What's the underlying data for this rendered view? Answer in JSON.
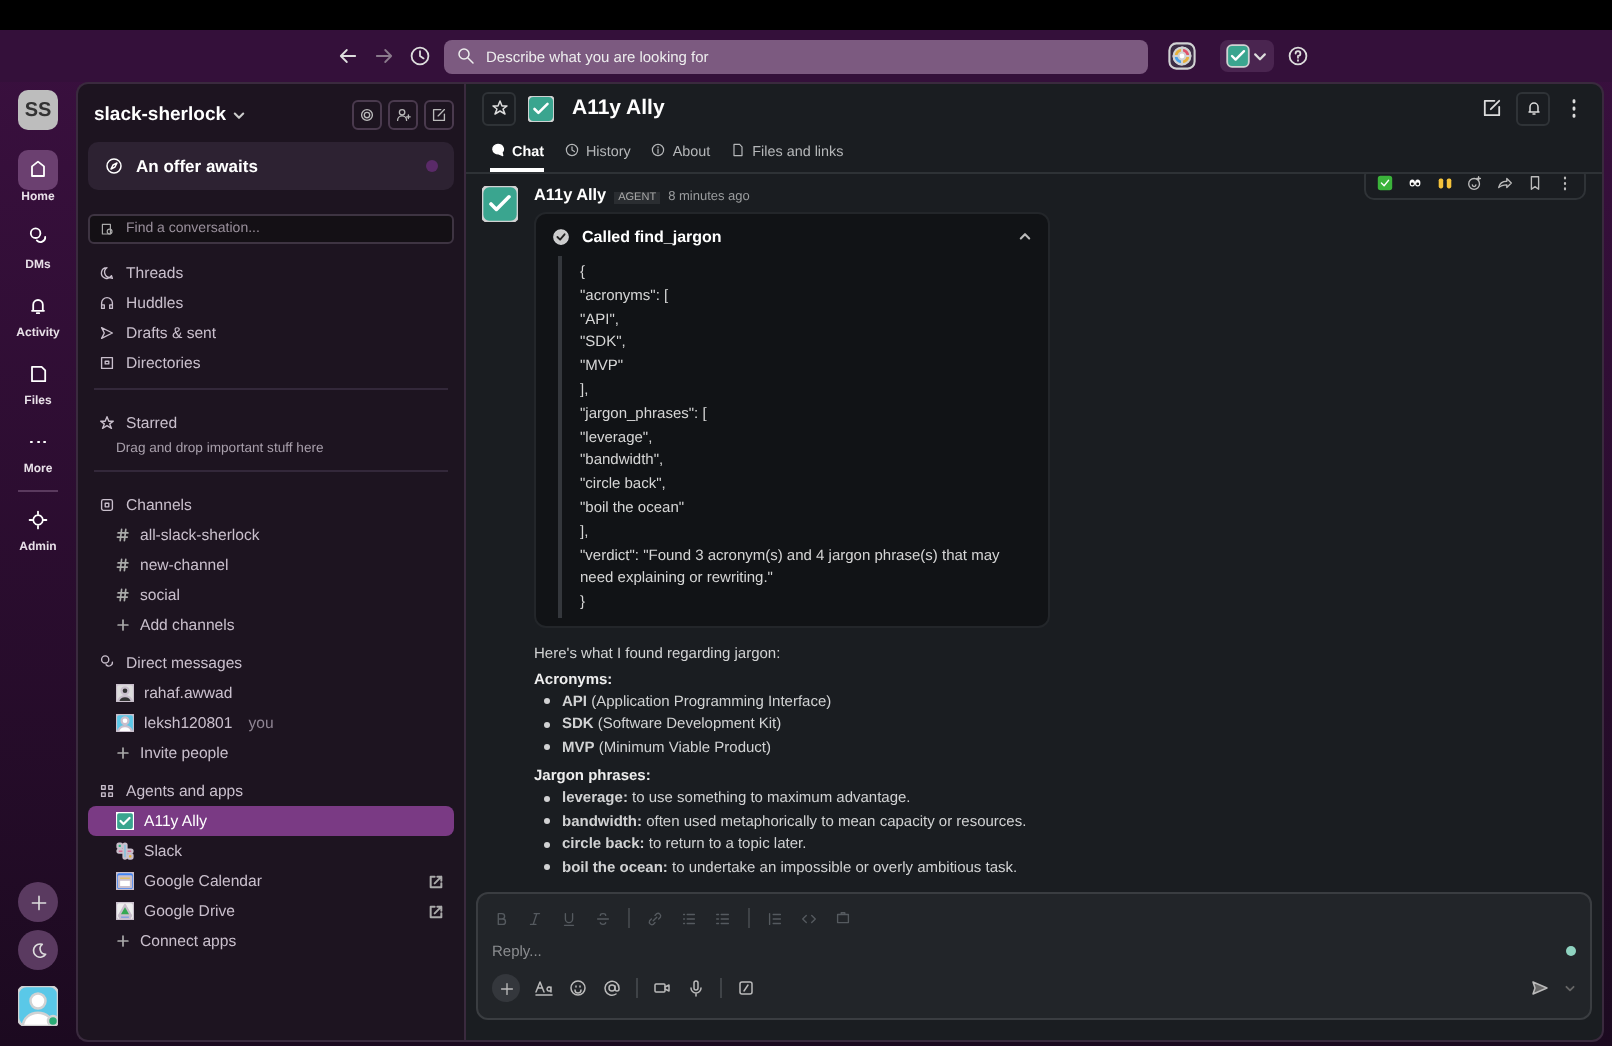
{
  "top_bar": {
    "search_placeholder": "Describe what you are looking for"
  },
  "rail": {
    "workspace_initials": "SS",
    "items": [
      {
        "label": "Home",
        "selected": true
      },
      {
        "label": "DMs",
        "selected": false
      },
      {
        "label": "Activity",
        "selected": false
      },
      {
        "label": "Files",
        "selected": false
      },
      {
        "label": "More",
        "selected": false
      },
      {
        "label": "Admin",
        "selected": false
      }
    ]
  },
  "sidebar": {
    "workspace": "slack-sherlock",
    "offer": "An offer awaits",
    "search_placeholder": "Find a conversation...",
    "nav": [
      "Threads",
      "Huddles",
      "Drafts & sent",
      "Directories"
    ],
    "starred": {
      "title": "Starred",
      "hint": "Drag and drop important stuff here"
    },
    "channels": {
      "title": "Channels",
      "items": [
        "all-slack-sherlock",
        "new-channel",
        "social"
      ],
      "add": "Add channels"
    },
    "direct_messages": {
      "title": "Direct messages",
      "items": [
        {
          "name": "rahaf.awwad"
        },
        {
          "name": "leksh120801",
          "suffix": "you"
        }
      ],
      "add": "Invite people"
    },
    "apps": {
      "title": "Agents and apps",
      "items": [
        {
          "name": "A11y Ally",
          "selected": true,
          "external": false
        },
        {
          "name": "Slack",
          "selected": false,
          "external": false
        },
        {
          "name": "Google Calendar",
          "selected": false,
          "external": true
        },
        {
          "name": "Google Drive",
          "selected": false,
          "external": true
        }
      ],
      "add": "Connect apps"
    }
  },
  "channel": {
    "title": "A11y Ally",
    "tabs": [
      {
        "label": "Chat",
        "selected": true
      },
      {
        "label": "History",
        "selected": false
      },
      {
        "label": "About",
        "selected": false
      },
      {
        "label": "Files and links",
        "selected": false
      }
    ]
  },
  "message": {
    "author": "A11y Ally",
    "badge": "AGENT",
    "time": "8 minutes ago",
    "tool_call": {
      "title": "Called find_jargon",
      "expanded": true,
      "lines": [
        "{",
        "\"acronyms\": [",
        "\"API\",",
        "\"SDK\",",
        "\"MVP\"",
        "],",
        "\"jargon_phrases\": [",
        "\"leverage\",",
        "\"bandwidth\",",
        "\"circle back\",",
        "\"boil the ocean\"",
        "],",
        "\"verdict\": \"Found 3 acronym(s) and 4 jargon phrase(s) that may need explaining or rewriting.\"",
        "}"
      ]
    },
    "intro": "Here's what I found regarding jargon:",
    "groups": [
      {
        "heading": "Acronyms:",
        "items": [
          "**API** (Application Programming Interface)",
          "**SDK** (Software Development Kit)",
          "**MVP** (Minimum Viable Product)"
        ]
      },
      {
        "heading": "Jargon phrases:",
        "items": [
          "**leverage:** to use something to maximum advantage.",
          "**bandwidth:** often used metaphorically to mean capacity or resources.",
          "**circle back:** to return to a topic later.",
          "**boil the ocean:** to undertake an impossible or overly ambitious task."
        ]
      }
    ]
  },
  "composer": {
    "placeholder": "Reply..."
  }
}
